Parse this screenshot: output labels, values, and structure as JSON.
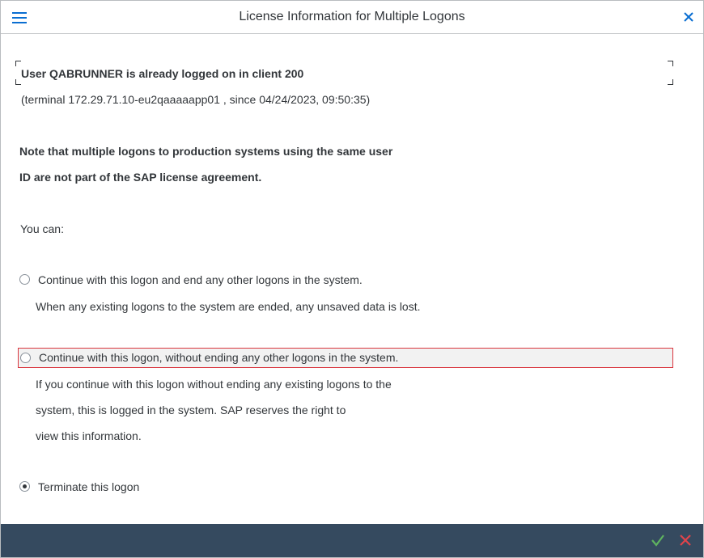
{
  "window": {
    "title": "License Information for Multiple Logons"
  },
  "message": {
    "heading": "User QABRUNNER is already logged on in client 200",
    "terminal_line": "(terminal 172.29.71.10-eu2qaaaaapp01 , since 04/24/2023, 09:50:35)",
    "note_line1": "Note that multiple logons to production systems using the same user",
    "note_line2": "ID are not part of the SAP license agreement.",
    "you_can": "You can:"
  },
  "options": [
    {
      "label": "Continue with this logon and end any other logons in the system.",
      "description": [
        "When any existing logons to the system are ended, any unsaved data is lost."
      ],
      "selected": false
    },
    {
      "label": "Continue with this logon, without ending any other logons in the system.",
      "description": [
        "If you continue with this logon without ending any existing logons to the",
        "system, this is logged in the system. SAP reserves the right to",
        "view this information."
      ],
      "selected": false,
      "focused": true
    },
    {
      "label": "Terminate this logon",
      "description": [],
      "selected": true
    }
  ],
  "icons": {
    "menu": "hamburger-icon",
    "close": "close-icon",
    "confirm": "checkmark-icon",
    "cancel": "cancel-icon"
  },
  "colors": {
    "focus_border": "#d9363e",
    "footer_bg": "#354a5f",
    "confirm_green": "#5fb35f",
    "cancel_red": "#e0444b",
    "accent_blue": "#0a6ed1"
  }
}
